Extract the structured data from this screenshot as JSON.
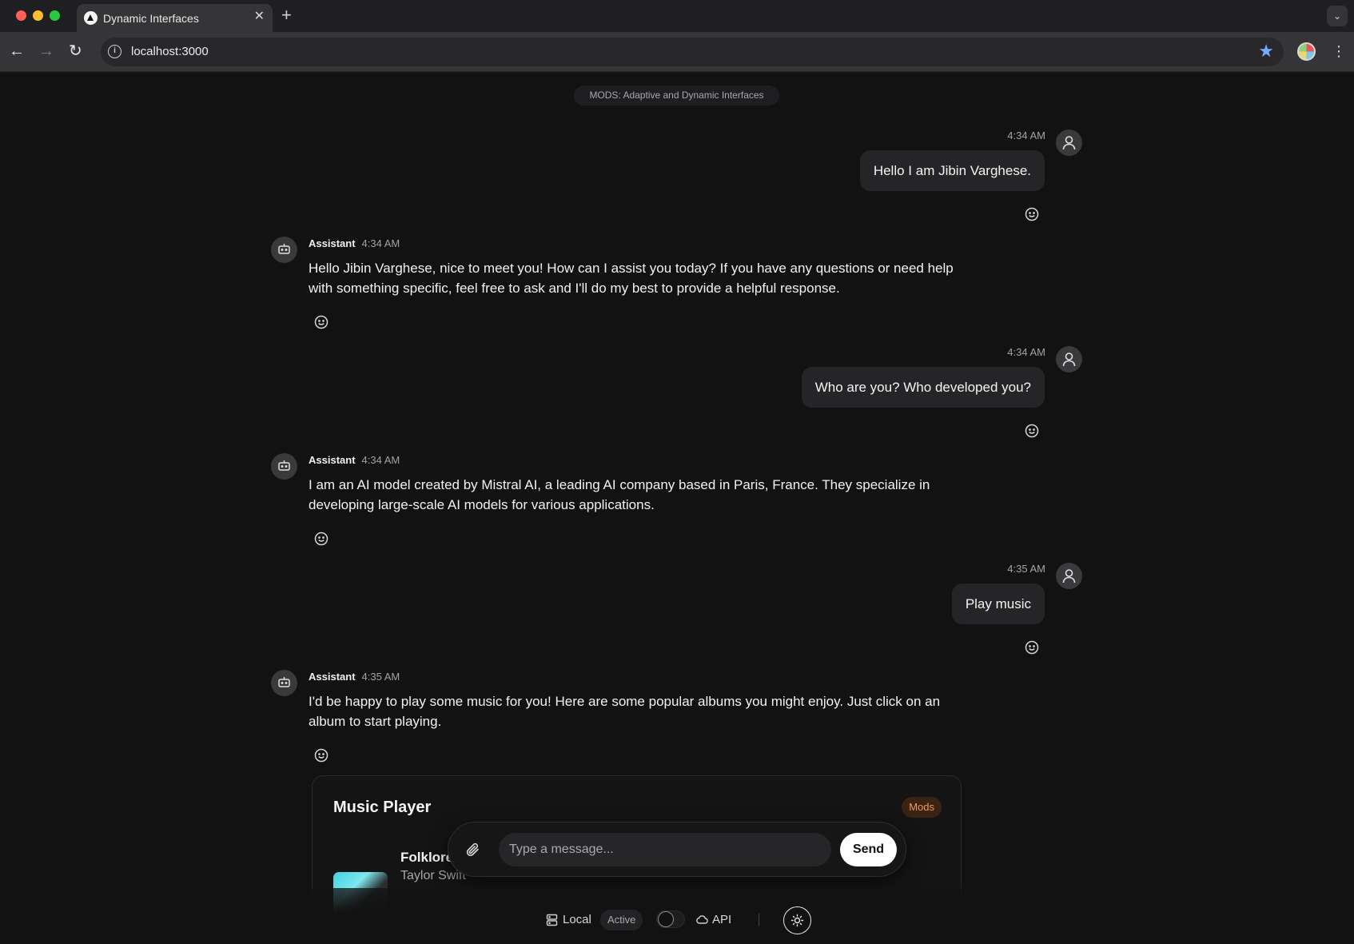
{
  "browser": {
    "tab_title": "Dynamic Interfaces",
    "tab_close": "✕",
    "new_tab": "+",
    "url": "localhost:3000"
  },
  "page": {
    "banner": "MODS: Adaptive and Dynamic Interfaces"
  },
  "messages": [
    {
      "role": "user",
      "time": "4:34 AM",
      "text": "Hello I am Jibin Varghese."
    },
    {
      "role": "assistant",
      "name": "Assistant",
      "time": "4:34 AM",
      "text": "Hello Jibin Varghese, nice to meet you! How can I assist you today? If you have any questions or need help with something specific, feel free to ask and I'll do my best to provide a helpful response."
    },
    {
      "role": "user",
      "time": "4:34 AM",
      "text": "Who are you? Who developed you?"
    },
    {
      "role": "assistant",
      "name": "Assistant",
      "time": "4:34 AM",
      "text": "I am an AI model created by Mistral AI, a leading AI company based in Paris, France. They specialize in developing large-scale AI models for various applications."
    },
    {
      "role": "user",
      "time": "4:35 AM",
      "text": "Play music"
    },
    {
      "role": "assistant",
      "name": "Assistant",
      "time": "4:35 AM",
      "text": "I'd be happy to play some music for you! Here are some popular albums you might enjoy. Just click on an album to start playing."
    }
  ],
  "music_player": {
    "title": "Music Player",
    "badge": "Mods",
    "albums": [
      {
        "name": "Folklore",
        "artist": "Taylor Swift"
      }
    ]
  },
  "composer": {
    "placeholder": "Type a message...",
    "send_label": "Send"
  },
  "status_bar": {
    "local_label": "Local",
    "active_label": "Active",
    "api_label": "API",
    "toggle_on": false
  },
  "icons": {
    "user_avatar": "user-icon",
    "assistant_avatar": "bot-icon",
    "reaction": "smiley-icon",
    "attach": "paperclip-icon",
    "local": "server-icon",
    "api": "cloud-icon",
    "settings": "sun-icon"
  },
  "colors": {
    "background": "#121212",
    "bubble": "#252527",
    "mods_badge_text": "#f09a56",
    "send_button": "#ffffff"
  }
}
